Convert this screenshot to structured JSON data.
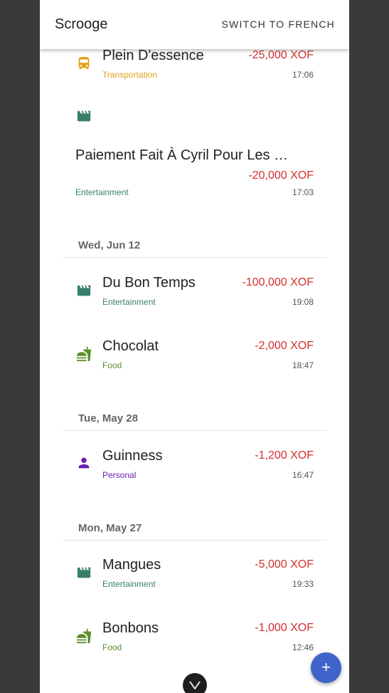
{
  "app": {
    "title": "Scrooge",
    "switch_label": "SWITCH TO FRENCH"
  },
  "colors": {
    "transportation": "#e6a11a",
    "entertainment": "#3a7f6c",
    "food": "#5e8e2c",
    "personal": "#6a1fb0",
    "amount": "#d32f2f",
    "fab": "#3f64c9"
  },
  "groups": [
    {
      "date": "",
      "transactions": [
        {
          "name": "Plein D'essence",
          "amount": "-25,000 XOF",
          "category": "Transportation",
          "time": "17:06",
          "icon": "bus-icon"
        },
        {
          "name": "Paiement Fait À Cyril Pour Les …",
          "amount": "-20,000 XOF",
          "category": "Entertainment",
          "time": "17:03",
          "icon": "clapperboard-icon"
        }
      ]
    },
    {
      "date": "Wed, Jun 12",
      "transactions": [
        {
          "name": "Du Bon Temps",
          "amount": "-100,000 XOF",
          "category": "Entertainment",
          "time": "19:08",
          "icon": "clapperboard-icon"
        },
        {
          "name": "Chocolat",
          "amount": "-2,000 XOF",
          "category": "Food",
          "time": "18:47",
          "icon": "fastfood-icon"
        }
      ]
    },
    {
      "date": "Tue, May 28",
      "transactions": [
        {
          "name": "Guinness",
          "amount": "-1,200 XOF",
          "category": "Personal",
          "time": "16:47",
          "icon": "person-icon"
        }
      ]
    },
    {
      "date": "Mon, May 27",
      "transactions": [
        {
          "name": "Mangues",
          "amount": "-5,000 XOF",
          "category": "Entertainment",
          "time": "19:33",
          "icon": "clapperboard-icon"
        },
        {
          "name": "Bonbons",
          "amount": "-1,000 XOF",
          "category": "Food",
          "time": "12:46",
          "icon": "fastfood-icon"
        }
      ]
    }
  ],
  "fab": {
    "label": "+"
  }
}
